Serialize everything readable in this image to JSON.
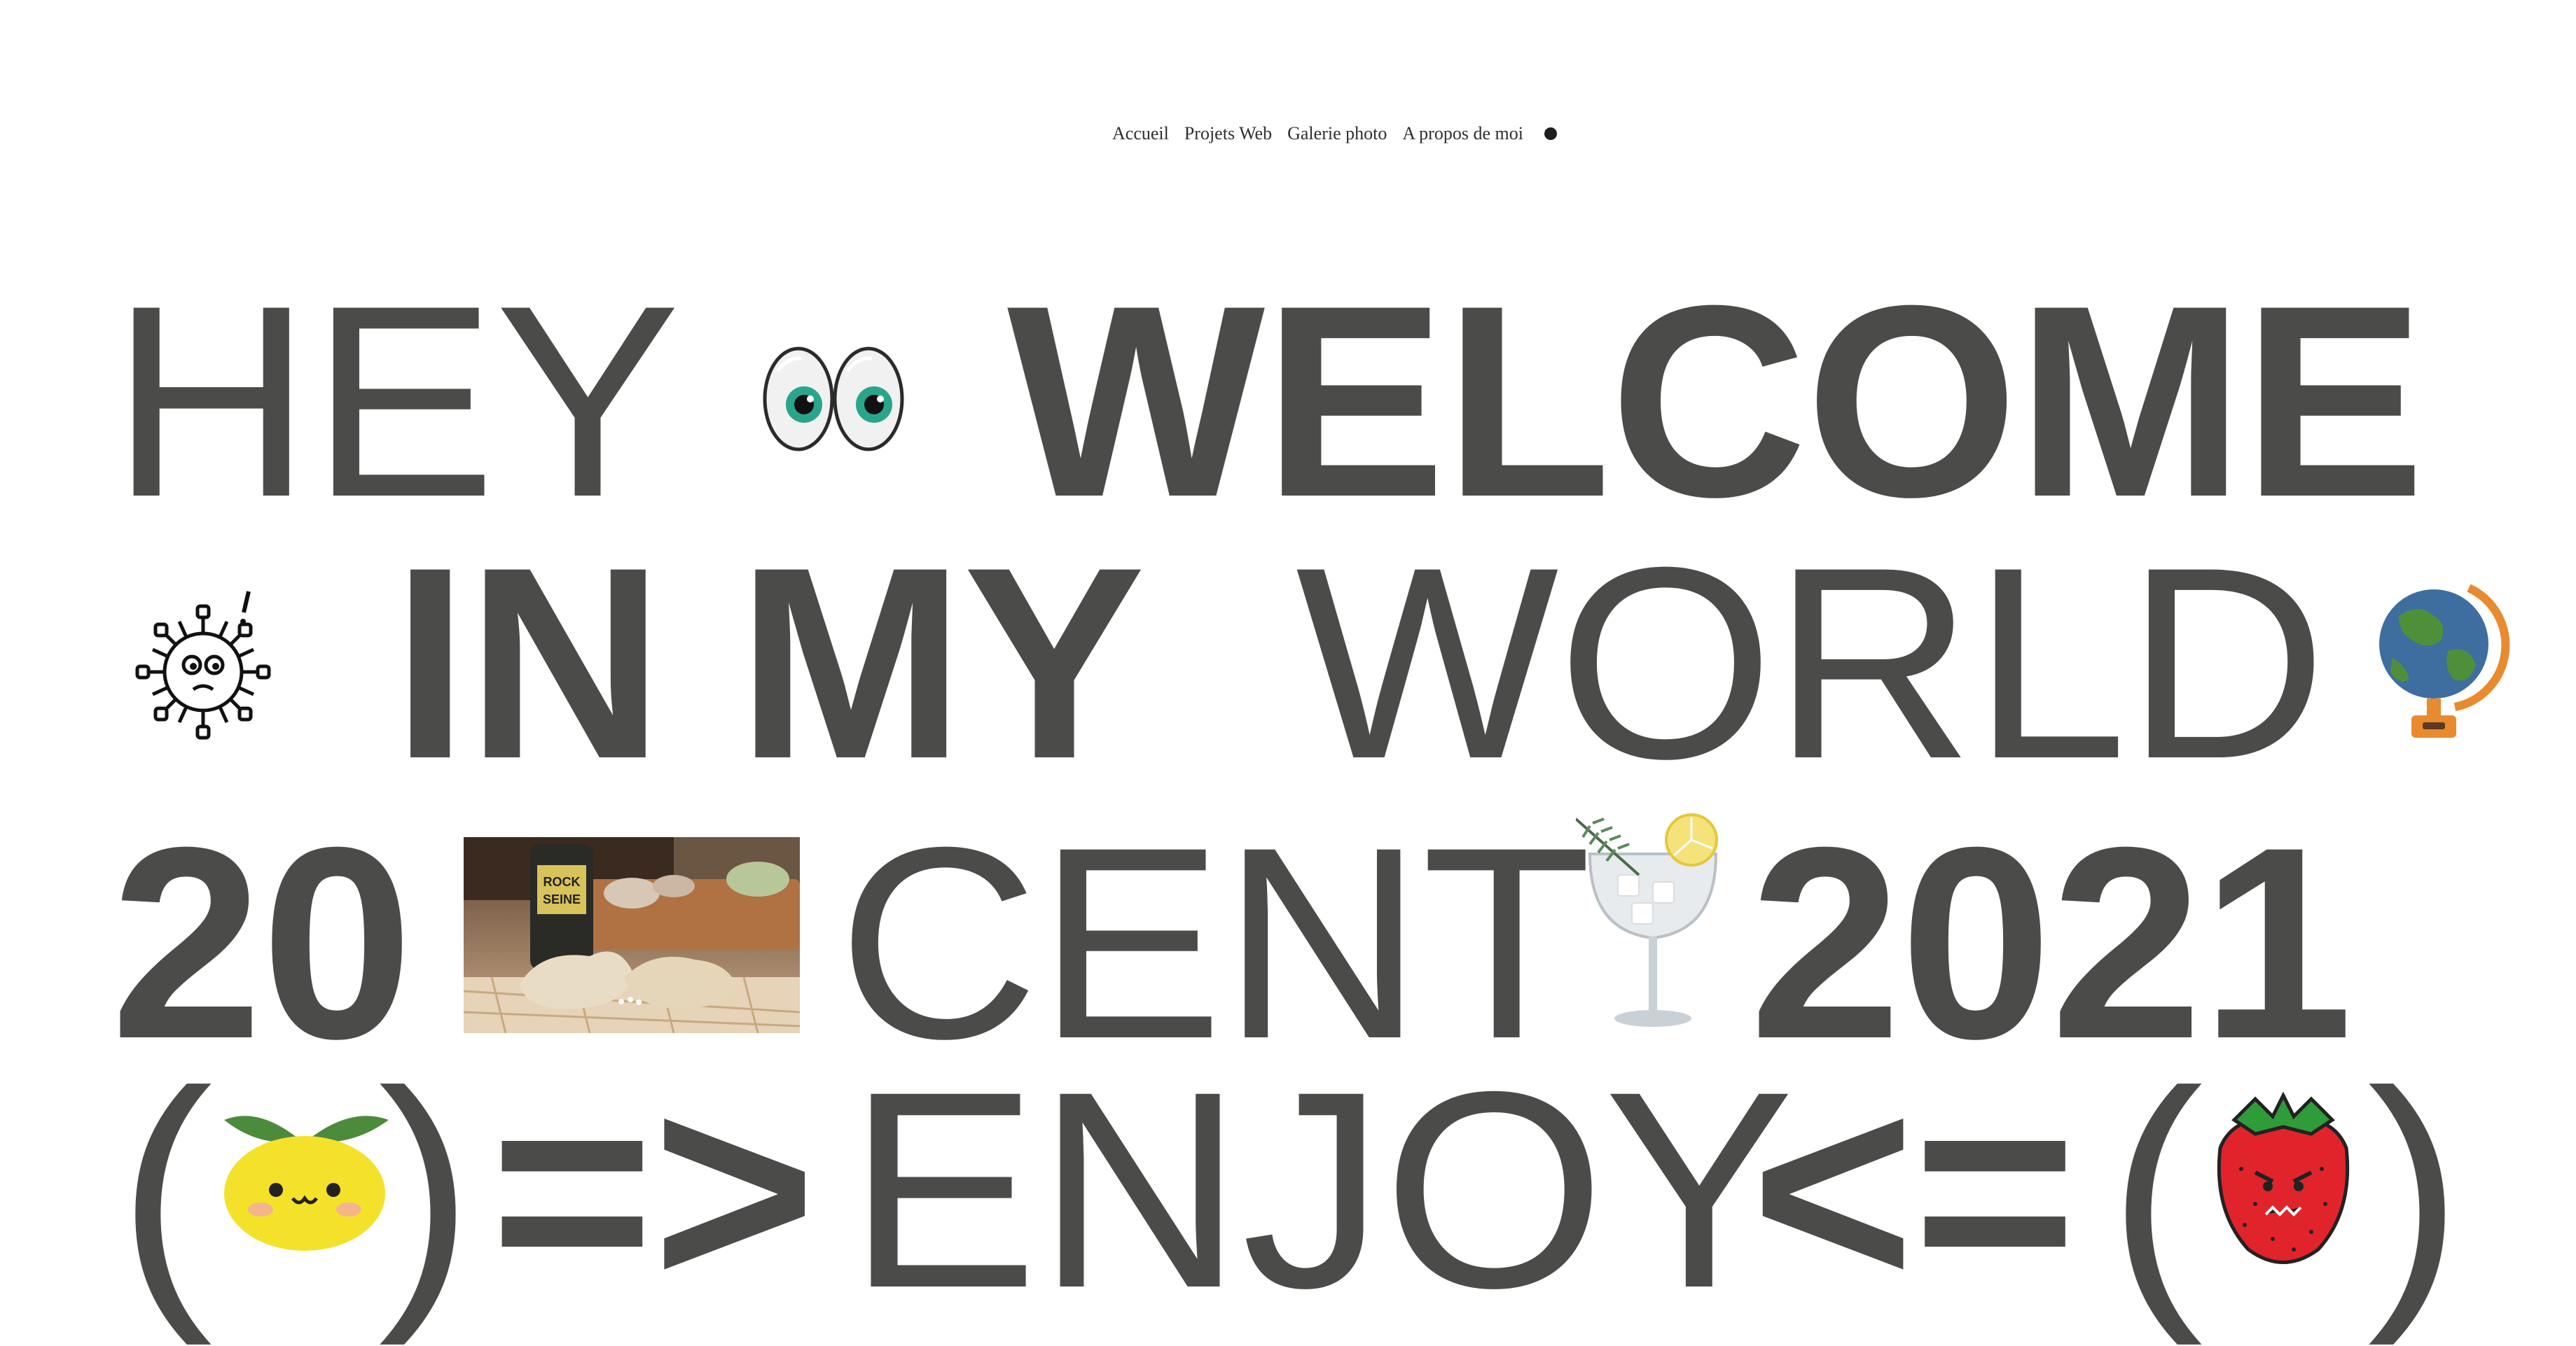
{
  "nav": {
    "items": [
      {
        "label": "Accueil"
      },
      {
        "label": "Projets Web"
      },
      {
        "label": "Galerie photo"
      },
      {
        "label": "A propos de moi"
      }
    ]
  },
  "hero": {
    "line1": {
      "word1": "HEY",
      "word2": "WELCOME"
    },
    "line2": {
      "word1": "IN MY",
      "word2": "WORLD"
    },
    "line3": {
      "word1": "20",
      "word2": "CENT",
      "word3": "2021"
    },
    "line4": {
      "open1": "(",
      "close1": ")",
      "arrow_right": "=>",
      "word": "ENJOY",
      "arrow_left": "<=",
      "open2": "(",
      "close2": ")"
    }
  },
  "colors": {
    "text": "#4b4b49",
    "background": "#ffffff"
  }
}
